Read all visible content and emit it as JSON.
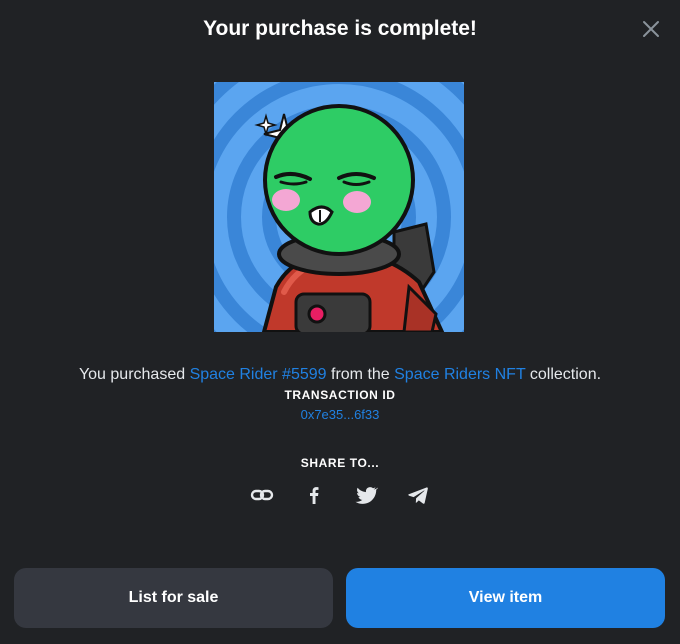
{
  "modal": {
    "title": "Your purchase is complete!"
  },
  "artwork": {
    "background_color": "#5ba5f0",
    "ring_color": "#3a86d8",
    "head_color": "#2ecc65",
    "suit_color": "#c0392b"
  },
  "purchase": {
    "prefix": "You purchased ",
    "item_name": "Space Rider #5599",
    "middle": " from the ",
    "collection_name": "Space Riders NFT",
    "suffix": " collection."
  },
  "transaction": {
    "label": "TRANSACTION ID",
    "id": "0x7e35...6f33"
  },
  "share": {
    "label": "SHARE TO...",
    "icons": [
      "link-icon",
      "facebook-icon",
      "twitter-icon",
      "telegram-icon"
    ]
  },
  "actions": {
    "list_for_sale": "List for sale",
    "view_item": "View item"
  },
  "colors": {
    "background": "#202225",
    "accent": "#2081e2",
    "secondary_button": "#353840"
  }
}
